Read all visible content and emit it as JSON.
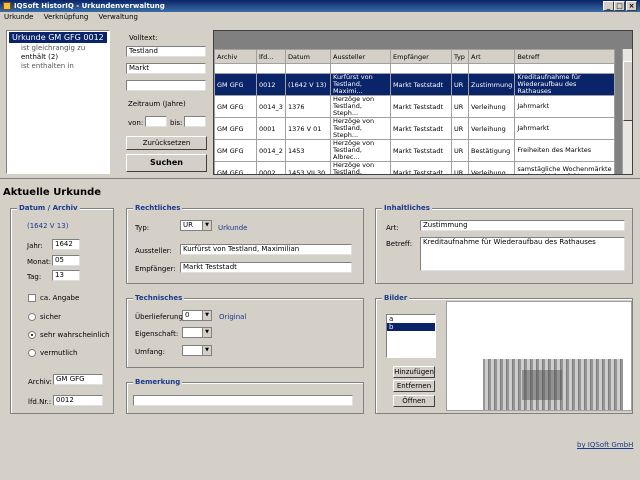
{
  "window": {
    "title": "IQSoft HistorIQ - Urkundenverwaltung"
  },
  "menu": {
    "items": [
      "Urkunde",
      "Verknüpfung",
      "Verwaltung"
    ]
  },
  "tree": {
    "root": "Urkunde GM GFG 0012",
    "children": [
      "ist gleichrangig zu",
      "enthält (2)",
      "ist enthalten in"
    ]
  },
  "search": {
    "volltext_label": "Volltext:",
    "field1": "Testland",
    "field2": "Markt",
    "field3": "",
    "zeitraum_label": "Zeitraum (Jahre)",
    "von_label": "von:",
    "bis_label": "bis:",
    "reset_button": "Zurücksetzen",
    "search_button": "Suchen"
  },
  "grid": {
    "columns": [
      "Archiv",
      "lfd...",
      "Datum",
      "Aussteller",
      "Empfänger",
      "Typ",
      "Art",
      "Betreff"
    ],
    "rows": [
      [
        "GM GFG",
        "0012",
        "(1642 V 13)",
        "Kurfürst von Testland, Maximi...",
        "Markt Teststadt",
        "UR",
        "Zustimmung",
        "Kreditaufnahme für Wiederaufbau des Rathauses"
      ],
      [
        "GM GFG",
        "0014_3",
        "1376",
        "Herzöge von Testland, Steph...",
        "Markt Teststadt",
        "UR",
        "Verleihung",
        "Jahrmarkt"
      ],
      [
        "GM GFG",
        "0001",
        "1376 V 01",
        "Herzöge von Testland, Steph...",
        "Markt Teststadt",
        "UR",
        "Verleihung",
        "Jahrmarkt"
      ],
      [
        "GM GFG",
        "0014_2",
        "1453",
        "Herzöge von Testland, Albrec...",
        "Markt Teststadt",
        "UR",
        "Bestätigung",
        "Freiheiten des Marktes"
      ],
      [
        "GM GFG",
        "0002",
        "1453 VII 30",
        "Herzöge von Testland, Albrec...",
        "Markt Teststadt",
        "UR",
        "Verleihung",
        "samstägliche Wochenmärkte und zwei Jahrmärkte"
      ]
    ],
    "selected_row": 0
  },
  "current": {
    "heading": "Aktuelle Urkunde",
    "datum_group": "Datum / Archiv",
    "datum_display": "(1642 V 13)",
    "jahr_label": "Jahr:",
    "jahr": "1642",
    "monat_label": "Monat:",
    "monat": "05",
    "tag_label": "Tag:",
    "tag": "13",
    "ca_label": "ca. Angabe",
    "radio_sicher": "sicher",
    "radio_sehr": "sehr wahrscheinlich",
    "radio_vermutlich": "vermutlich",
    "archiv_label": "Archiv:",
    "archiv": "GM GFG",
    "lfdnr_label": "lfd.Nr.:",
    "lfdnr": "0012"
  },
  "rechtliches": {
    "group": "Rechtliches",
    "typ_label": "Typ:",
    "typ": "UR",
    "typ_text": "Urkunde",
    "aussteller_label": "Aussteller:",
    "aussteller": "Kurfürst von Testland, Maximilian",
    "empfaenger_label": "Empfänger:",
    "empfaenger": "Markt Teststadt"
  },
  "technisches": {
    "group": "Technisches",
    "ueberlieferung_label": "Überlieferung:",
    "ueberlieferung": "0",
    "ueberlieferung_text": "Original",
    "eigenschaft_label": "Eigenschaft:",
    "umfang_label": "Umfang:"
  },
  "bemerkung": {
    "group": "Bemerkung",
    "value": ""
  },
  "inhaltliches": {
    "group": "Inhaltliches",
    "art_label": "Art:",
    "art": "Zustimmung",
    "betreff_label": "Betreff:",
    "betreff": "Kreditaufnahme für Wiederaufbau des Rathauses"
  },
  "bilder": {
    "group": "Bilder",
    "list": [
      "a",
      "b"
    ],
    "selected": 1,
    "add_button": "Hinzufügen",
    "remove_button": "Entfernen",
    "open_button": "Öffnen"
  },
  "footer": {
    "credit": "by IQSoft GmbH"
  }
}
